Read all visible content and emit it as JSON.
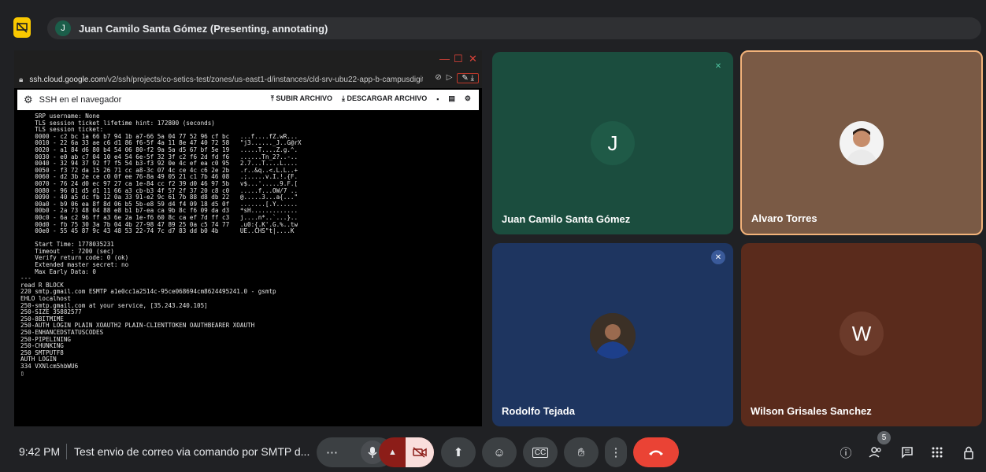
{
  "presenter": {
    "initial": "J",
    "label": "Juan Camilo Santa Gómez (Presenting, annotating)"
  },
  "browser": {
    "url_host": "ssh.cloud.google.com",
    "url_path": "/v2/ssh/projects/co-setics-test/zones/us-east1-d/instances/cld-srv-ubu22-app-b-campusdigita"
  },
  "ssh": {
    "title": "SSH en el navegador",
    "upload": "SUBIR ARCHIVO",
    "download": "DESCARGAR ARCHIVO"
  },
  "terminal_lines": [
    "    SRP username: None",
    "    TLS session ticket lifetime hint: 172800 (seconds)",
    "    TLS session ticket:",
    "    0000 - c2 bc 1a 66 b7 94 1b a7-66 5a 04 77 52 96 cf bc   ...f....fZ.wR...",
    "    0010 - 22 6a 33 ae c6 d1 86 f6-5f 4a 11 8e 47 40 72 58   \"j3......_J..G@rX",
    "    0020 - a1 84 d6 80 b4 54 06 80-f2 9a 5a d5 67 bf 5e 19   .....T....Z.g.^.",
    "    0030 - e0 ab c7 04 10 e4 54 6e-5f 32 3f c2 f6 2d fd f6   ......Tn_2?..-..",
    "    0040 - 32 94 37 92 f7 f5 54 b3-f3 92 0e 4c ef ea c0 95   2.7...T....L....",
    "    0050 - f3 72 da 15 26 71 cc a8-3c 07 4c ce 4c c6 2e 2b   .r..&q..<.L.L..+",
    "    0060 - d2 3b 2e ce c0 0f ee 76-8a 49 05 21 c1 7b 46 08   .;.....v.I.!.{F.",
    "    0070 - 76 24 d0 ec 97 27 ca 1e-84 cc f2 39 d0 46 97 5b   v$...'.....9.F.[",
    "    0080 - 96 01 d5 d1 11 66 a3 cb-b3 4f 57 2f 37 20 c8 c0   .....f...OW/7 ..",
    "    0090 - 40 a5 dc fb 12 0a 33 91-e2 9c 61 7b 88 d8 db 22   @.....3...a{...\"",
    "    00a0 - b9 06 ea 8f 8d 06 b5 5b-e8 59 d4 f4 09 18 d5 0f   .......[.Y......",
    "    00b0 - 2a 73 48 04 88 e8 b1 b7-ea ca 9b 8c f6 09 da d3   *sH.............",
    "    00c0 - 6a c2 96 ff a3 6e 2a 1e-f6 60 8c ca ef 7d ff c3   j....n*..`...}..",
    "    00d0 - fb 75 30 3a 7b 04 4b 27-98 47 89 25 0a c5 74 77   .u0:{.K'.G.%..tw",
    "    00e0 - 55 45 87 9c 43 48 53 22-74 7c d7 83 dd b0 4b      UE..CHS\"t|....K",
    "",
    "    Start Time: 1778035231",
    "    Timeout   : 7200 (sec)",
    "    Verify return code: 0 (ok)",
    "    Extended master secret: no",
    "    Max Early Data: 0",
    "---",
    "read R BLOCK",
    "220 smtp.gmail.com ESMTP a1e0cc1a2514c-95ce068694cm8624495241.0 - gsmtp",
    "EHLO localhost",
    "250-smtp.gmail.com at your service, [35.243.240.105]",
    "250-SIZE 35882577",
    "250-8BITMIME",
    "250-AUTH LOGIN PLAIN XOAUTH2 PLAIN-CLIENTTOKEN OAUTHBEARER XOAUTH",
    "250-ENHANCEDSTATUSCODES",
    "250-PIPELINING",
    "250-CHUNKING",
    "250 SMTPUTF8",
    "AUTH LOGIN",
    "334 VXNlcm5hbWU6",
    "▯"
  ],
  "participants": [
    {
      "name": "Juan Camilo Santa Gómez",
      "initial": "J",
      "bg": "#1b4d3e",
      "avatar_bg": "#1f5a47"
    },
    {
      "name": "Alvaro Torres",
      "initial": "",
      "bg": "#7a5a45",
      "border": "#f3b37a"
    },
    {
      "name": "Rodolfo Tejada",
      "initial": "",
      "bg": "#1e3560"
    },
    {
      "name": "Wilson Grisales Sanchez",
      "initial": "W",
      "bg": "#5a2b1c",
      "avatar_bg": "#6b3a2a"
    }
  ],
  "footer": {
    "time": "9:42 PM",
    "meeting_title": "Test envio de correo via comando por SMTP d...",
    "people_count": "5"
  },
  "colors": {
    "accent_yellow": "#f9c800",
    "end_call_red": "#ea4335",
    "camera_off_bg": "#f9dedc",
    "camera_group_bg": "#8c1d18"
  }
}
